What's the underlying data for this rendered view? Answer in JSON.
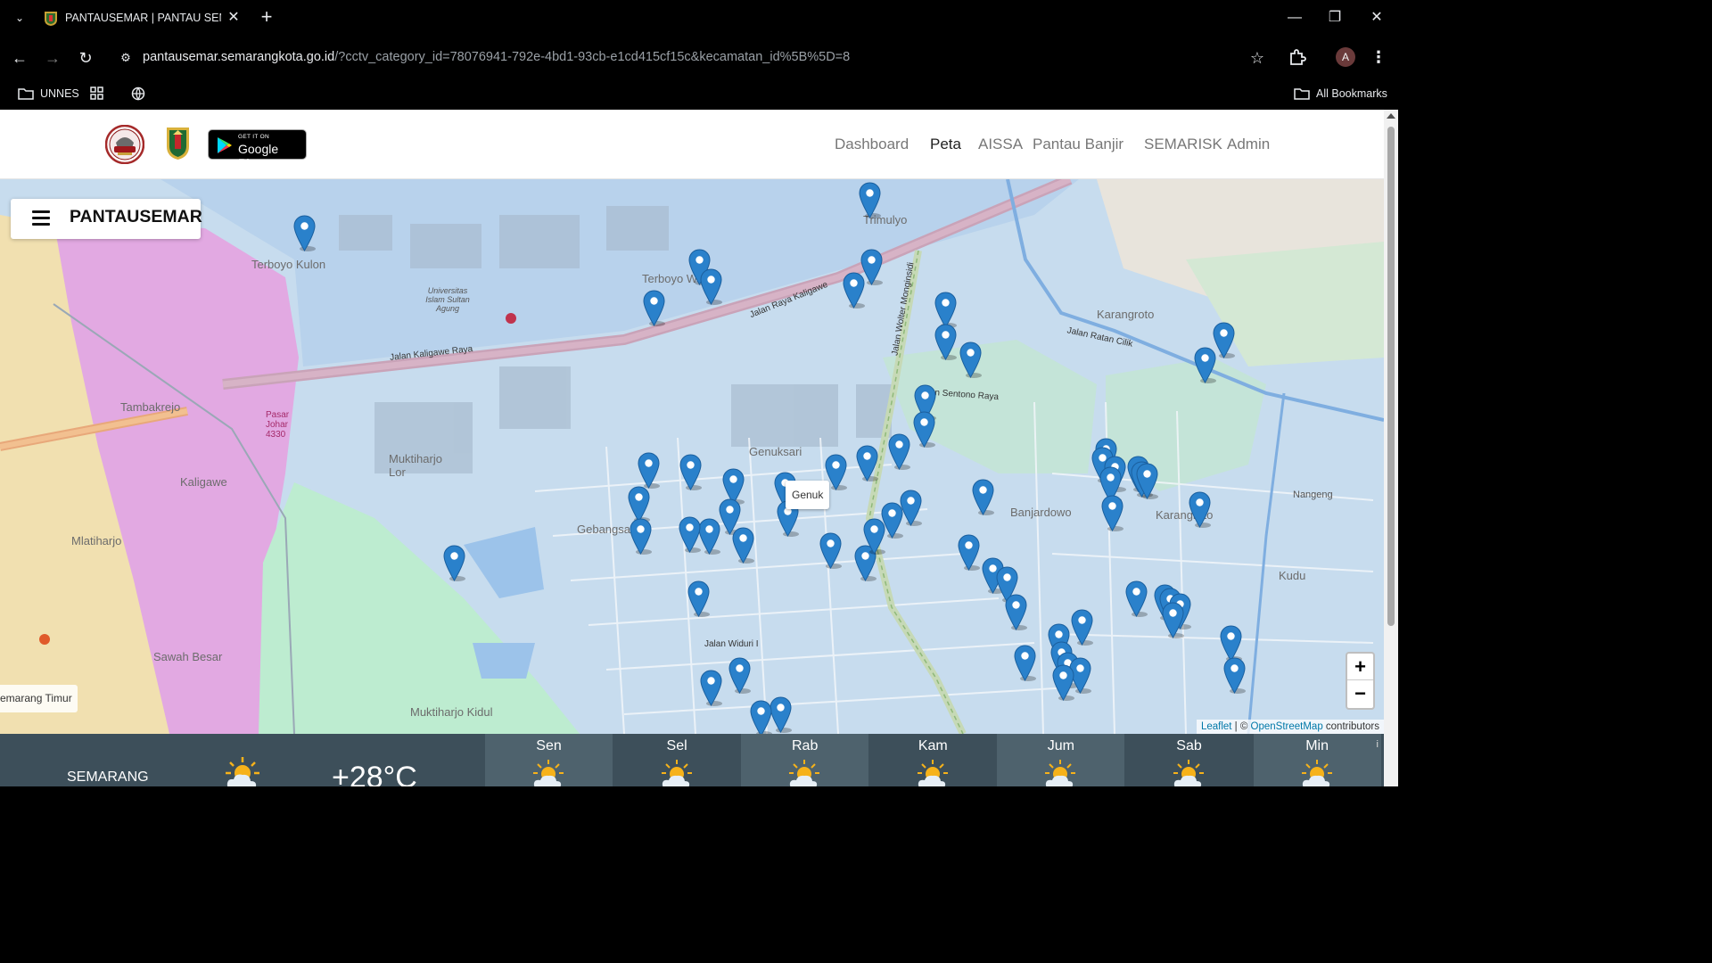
{
  "browser": {
    "tab_title": "PANTAUSEMAR | PANTAU SEMARANG",
    "url_host": "pantausemar.semarangkota.go.id",
    "url_path": "/?cctv_category_id=78076941-792e-4bd1-93cb-e1cd415cf15c&kecamatan_id%5B%5D=8",
    "profile_initial": "A",
    "bookmarks": [
      {
        "label": "UNNES",
        "icon": "folder-icon"
      },
      {
        "label": "",
        "icon": "apps-grid-icon"
      },
      {
        "label": "",
        "icon": "globe-icon"
      }
    ],
    "all_bookmarks": "All Bookmarks"
  },
  "header": {
    "play_get": "GET IT ON",
    "play_name": "Google Play",
    "nav": [
      "Dashboard",
      "Peta",
      "AISSA",
      "Pantau Banjir",
      "SEMARISK",
      "Admin"
    ],
    "active_nav": "Peta"
  },
  "map": {
    "panel_title": "PANTAUSEMAR",
    "tooltip": "Genuk",
    "kecamatan_label": "emarang Timur",
    "zoom_in": "+",
    "zoom_out": "−",
    "attribution": {
      "leaflet": "Leaflet",
      "sep": " | © ",
      "osm": "OpenStreetMap",
      "tail": " contributors"
    },
    "place_labels": [
      "Terboyo Kulon",
      "Terboyo Wetan",
      "Trimulyo",
      "Universitas Islam Sultan Agung",
      "Tambakrejo",
      "Kaligawe",
      "Muktiharjo Lor",
      "Genuksari",
      "Gebangsari",
      "Banjardowo",
      "Karangroto",
      "Kudu",
      "Mlatiharjo",
      "Sawah Besar",
      "Muktiharjo Kidul",
      "Nangeng",
      "Pasar Johar 4330",
      "Karangroto"
    ],
    "road_labels": [
      "Jalan Kaligawe Raya",
      "Jalan Raya Kaligawe",
      "Jalan Wolter Monginsidi",
      "Jalan Ratan Cilik",
      "Jalan Sentono Raya",
      "Jalan Widuri I"
    ]
  },
  "weather": {
    "city": "SEMARANG",
    "temperature": "+28°C",
    "days": [
      "Sen",
      "Sel",
      "Rab",
      "Kam",
      "Jum",
      "Sab",
      "Min"
    ],
    "icon": "partly-cloudy-sun-icon",
    "info": "i"
  },
  "colors": {
    "map_water": "#cfe0ee",
    "district_pink": "#e6b0e6",
    "district_green": "#bfeed0",
    "district_yellow": "#f1e3b4",
    "marker_blue": "#2a81cb",
    "weather_bg": "#3d4f5a"
  }
}
